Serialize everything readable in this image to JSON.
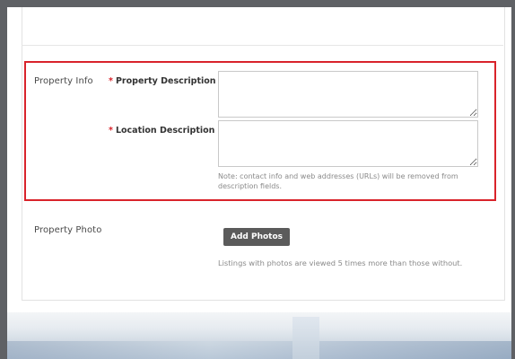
{
  "form": {
    "property_info": {
      "section_label": "Property Info",
      "required_marker": "*",
      "property_description_label": "Property Description",
      "property_description_value": "",
      "location_description_label": "Location Description",
      "location_description_value": "",
      "note": "Note: contact info and web addresses (URLs) will be removed from description fields."
    },
    "property_photo": {
      "section_label": "Property Photo",
      "add_photos_label": "Add Photos",
      "hint": "Listings with photos are viewed 5 times more than those without."
    }
  },
  "colors": {
    "highlight": "#d9232b",
    "required": "#d9232b",
    "button_bg": "#5b5b5b",
    "backdrop": "#5f6165"
  }
}
